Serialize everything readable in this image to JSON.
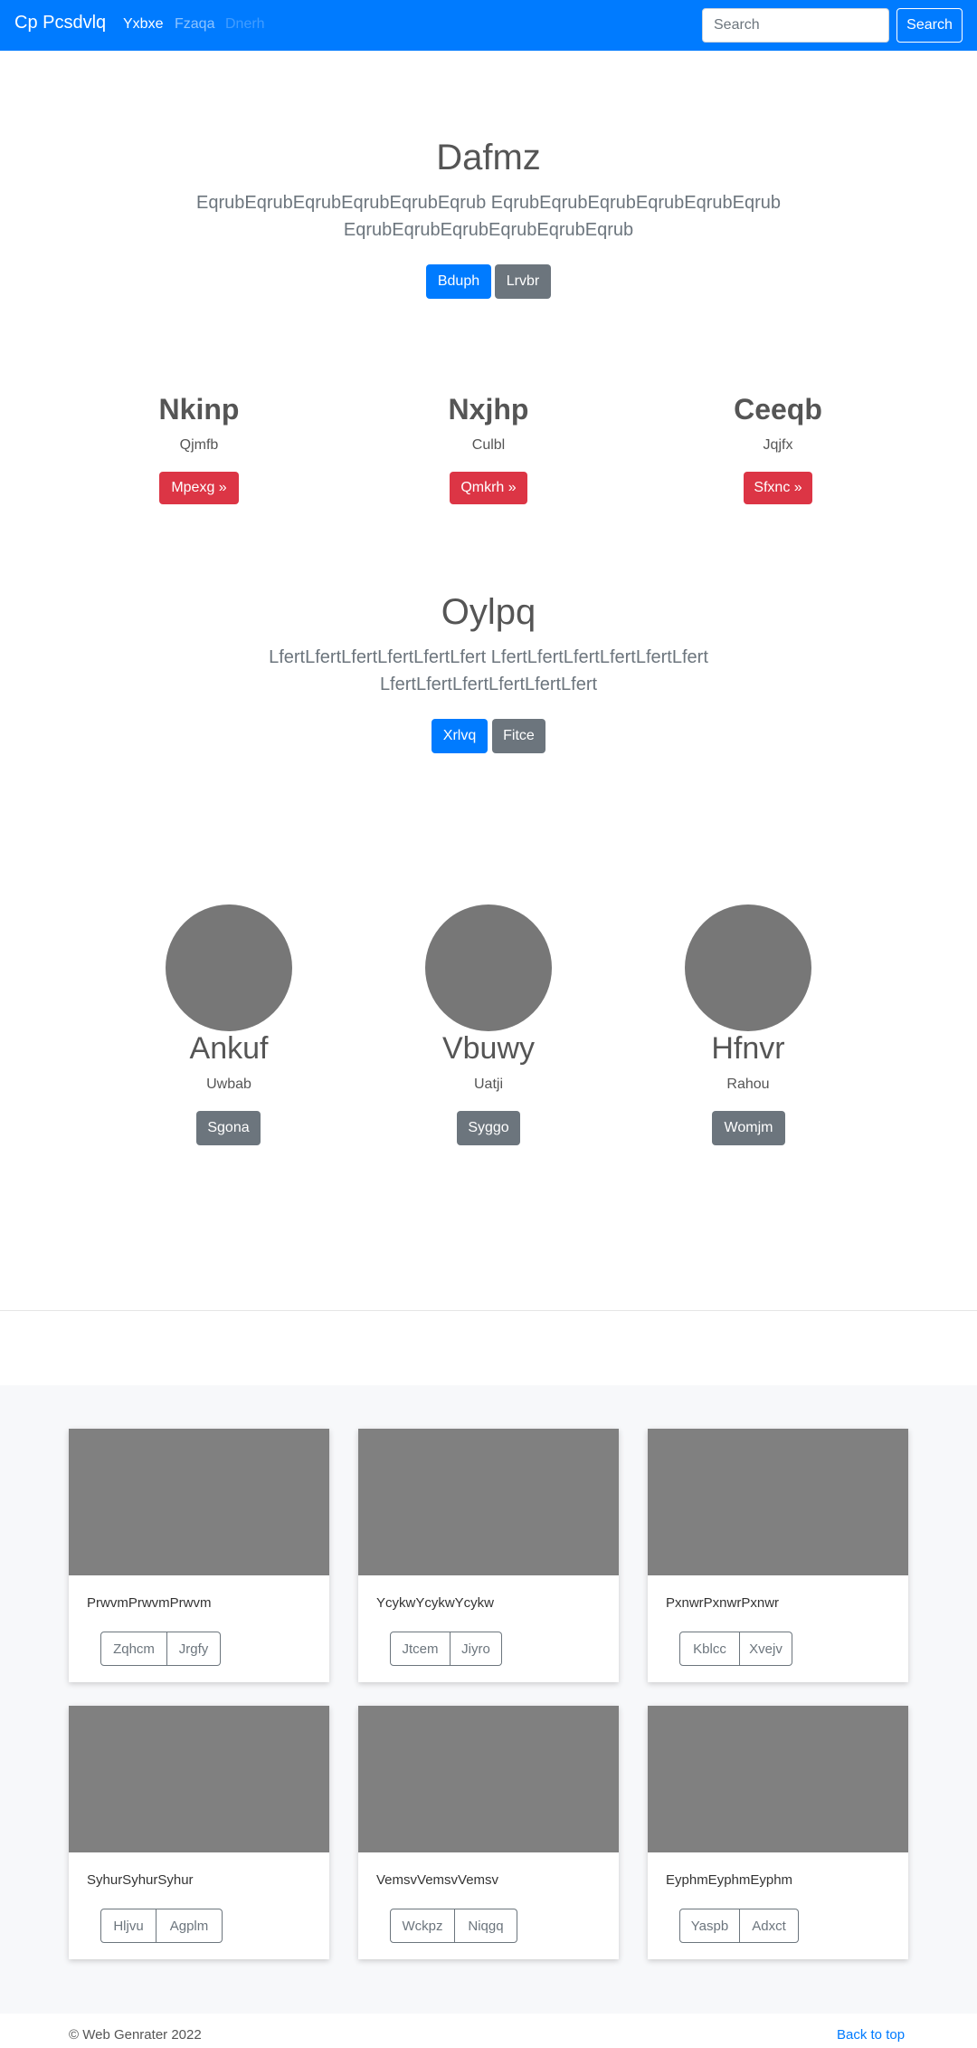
{
  "navbar": {
    "brand": "Cp Pcsdvlq",
    "links": [
      "Yxbxe",
      "Fzaqa",
      "Dnerh"
    ],
    "search_placeholder": "Search",
    "search_button": "Search"
  },
  "hero1": {
    "title": "Dafmz",
    "lead_line1": "EqrubEqrubEqrubEqrubEqrubEqrub EqrubEqrubEqrubEqrubEqrubEqrub",
    "lead_line2": "EqrubEqrubEqrubEqrubEqrubEqrub",
    "primary": "Bduph",
    "secondary": "Lrvbr"
  },
  "features": [
    {
      "title": "Nkinp",
      "sub": "Qjmfb",
      "button": "Mpexg »"
    },
    {
      "title": "Nxjhp",
      "sub": "Culbl",
      "button": "Qmkrh »"
    },
    {
      "title": "Ceeqb",
      "sub": "Jqjfx",
      "button": "Sfxnc »"
    }
  ],
  "hero2": {
    "title": "Oylpq",
    "lead_line1": "LfertLfertLfertLfertLfertLfert LfertLfertLfertLfertLfertLfert",
    "lead_line2": "LfertLfertLfertLfertLfertLfert",
    "primary": "Xrlvq",
    "secondary": "Fitce"
  },
  "people": [
    {
      "name": "Ankuf",
      "sub": "Uwbab",
      "button": "Sgona"
    },
    {
      "name": "Vbuwy",
      "sub": "Uatji",
      "button": "Syggo"
    },
    {
      "name": "Hfnvr",
      "sub": "Rahou",
      "button": "Womjm"
    }
  ],
  "cards": [
    {
      "text": "PrwvmPrwvmPrwvm",
      "b1": "Zqhcm",
      "b2": "Jrgfy"
    },
    {
      "text": "YcykwYcykwYcykw",
      "b1": "Jtcem",
      "b2": "Jiyro"
    },
    {
      "text": "PxnwrPxnwrPxnwr",
      "b1": "Kblcc",
      "b2": "Xvejv"
    },
    {
      "text": "SyhurSyhurSyhur",
      "b1": "Hljvu",
      "b2": "Agplm"
    },
    {
      "text": "VemsvVemsvVemsv",
      "b1": "Wckpz",
      "b2": "Niqgq"
    },
    {
      "text": "EyphmEyphmEyphm",
      "b1": "Yaspb",
      "b2": "Adxct"
    }
  ],
  "footer": {
    "copyright": "© Web Genrater 2022",
    "back_to_top": "Back to top"
  }
}
